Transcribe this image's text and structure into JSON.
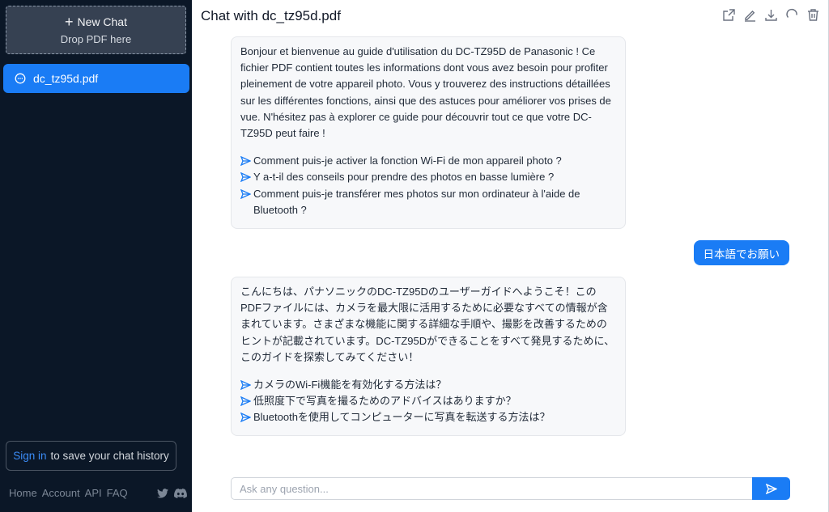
{
  "sidebar": {
    "new_chat_label": "New Chat",
    "drop_label": "Drop PDF here",
    "chats": [
      {
        "label": "dc_tz95d.pdf"
      }
    ],
    "signin_link": "Sign in",
    "signin_text": "to save your chat history",
    "footer_links": [
      "Home",
      "Account",
      "API",
      "FAQ"
    ],
    "social_icons": [
      "twitter-icon",
      "discord-icon"
    ]
  },
  "header": {
    "title": "Chat with dc_tz95d.pdf",
    "toolbar_icons": [
      "share-icon",
      "edit-icon",
      "download-icon",
      "refresh-icon",
      "trash-icon"
    ]
  },
  "messages": {
    "bot1": {
      "text": "Bonjour et bienvenue au guide d'utilisation du DC-TZ95D de Panasonic ! Ce fichier PDF contient toutes les informations dont vous avez besoin pour profiter pleinement de votre appareil photo. Vous y trouverez des instructions détaillées sur les différentes fonctions, ainsi que des astuces pour améliorer vos prises de vue. N'hésitez pas à explorer ce guide pour découvrir tout ce que votre DC-TZ95D peut faire !",
      "questions": [
        "Comment puis-je activer la fonction Wi-Fi de mon appareil photo ?",
        "Y a-t-il des conseils pour prendre des photos en basse lumière ?",
        "Comment puis-je transférer mes photos sur mon ordinateur à l'aide de Bluetooth ?"
      ]
    },
    "user1": {
      "text": "日本語でお願い"
    },
    "bot2": {
      "text": "こんにちは、パナソニックのDC-TZ95Dのユーザーガイドへようこそ！このPDFファイルには、カメラを最大限に活用するために必要なすべての情報が含まれています。さまざまな機能に関する詳細な手順や、撮影を改善するためのヒントが記載されています。DC-TZ95Dができることをすべて発見するために、このガイドを探索してみてください！",
      "questions": [
        "カメラのWi-Fi機能を有効化する方法は？",
        "低照度下で写真を撮るためのアドバイスはありますか？",
        "Bluetoothを使用してコンピューターに写真を転送する方法は？"
      ]
    }
  },
  "input": {
    "value": "",
    "placeholder": "Ask any question..."
  },
  "colors": {
    "accent": "#1a7cf5",
    "sidebar_bg": "#0b1727",
    "bubble_bg": "#f7f8fa"
  }
}
